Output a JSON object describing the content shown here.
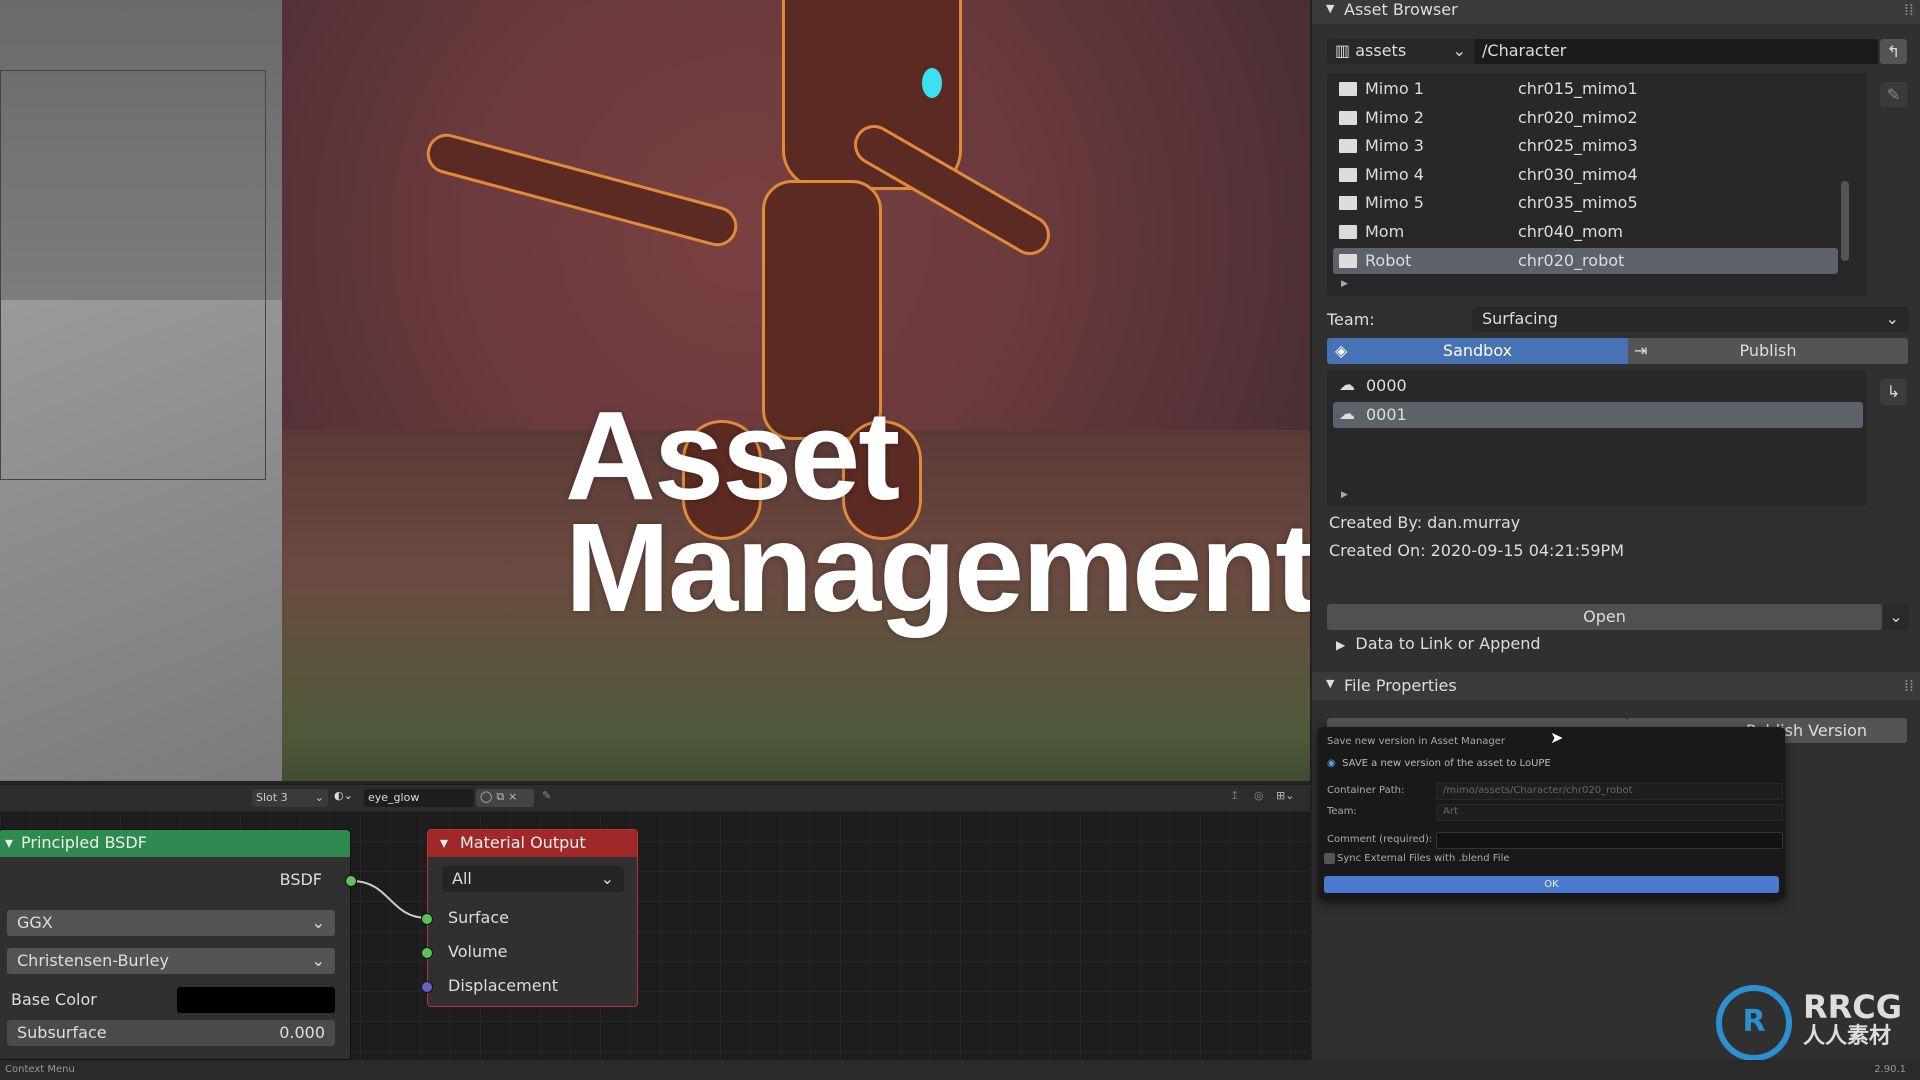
{
  "overlay_title": {
    "line1": "Asset",
    "line2": "Management"
  },
  "node_header": {
    "slot": "Slot 3",
    "material": "eye_glow"
  },
  "nodes": {
    "principled": {
      "title": "Principled BSDF",
      "output": "BSDF",
      "distribution": "GGX",
      "subsurface_method": "Christensen-Burley",
      "base_color_label": "Base Color",
      "base_color": "#000000",
      "subsurface_label": "Subsurface",
      "subsurface_value": "0.000",
      "header_color": "#2e8a4e"
    },
    "material_output": {
      "title": "Material Output",
      "target": "All",
      "inputs": [
        "Surface",
        "Volume",
        "Displacement"
      ],
      "header_color": "#a02828"
    }
  },
  "asset_browser": {
    "title": "Asset Browser",
    "library": "assets",
    "path": "/Character",
    "items": [
      {
        "name": "Mimo 1",
        "code": "chr015_mimo1"
      },
      {
        "name": "Mimo 2",
        "code": "chr020_mimo2"
      },
      {
        "name": "Mimo 3",
        "code": "chr025_mimo3"
      },
      {
        "name": "Mimo 4",
        "code": "chr030_mimo4"
      },
      {
        "name": "Mimo 5",
        "code": "chr035_mimo5"
      },
      {
        "name": "Mom",
        "code": "chr040_mom"
      },
      {
        "name": "Robot",
        "code": "chr020_robot",
        "selected": true
      }
    ],
    "team_label": "Team:",
    "team": "Surfacing",
    "tabs": [
      {
        "label": "Sandbox",
        "active": true
      },
      {
        "label": "Publish",
        "active": false
      }
    ],
    "versions": [
      {
        "label": "0000"
      },
      {
        "label": "0001",
        "selected": true
      }
    ],
    "created_by": "Created By: dan.murray",
    "created_on": "Created On: 2020-09-15 04:21:59PM",
    "open_label": "Open",
    "data_link_label": "Data to Link or Append",
    "file_properties": "File Properties",
    "publish_version_label": "Publish Version",
    "accent": "#4772b3"
  },
  "popup": {
    "title": "Save new version in Asset Manager",
    "description": "SAVE a new version of the asset to LoUPE",
    "container_path_label": "Container Path:",
    "container_path": "/mimo/assets/Character/chr020_robot",
    "team_label": "Team:",
    "team": "Art",
    "comment_label": "Comment (required):",
    "comment": "",
    "sync_label": "Sync External Files with .blend File",
    "sync_checked": false,
    "ok_label": "OK"
  },
  "status": {
    "left": "Context Menu",
    "version": "2.90.1"
  },
  "watermark": {
    "text": "RRCG",
    "subtext": "人人素材"
  }
}
